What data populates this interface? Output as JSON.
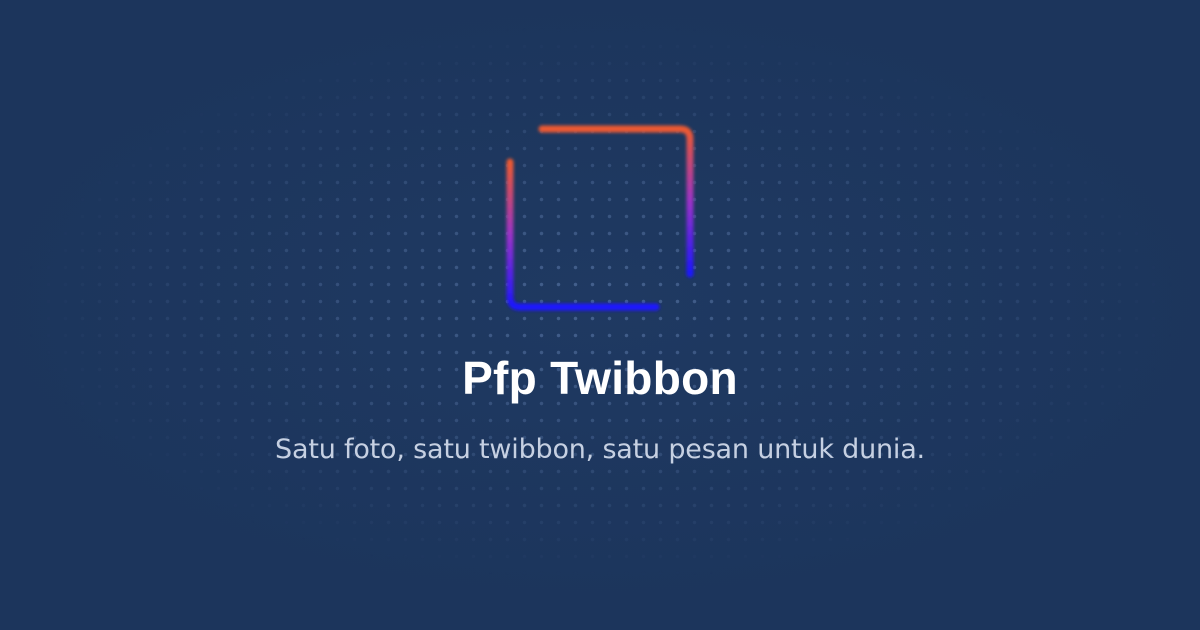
{
  "logo": {
    "icon": "gradient-square-frame-icon",
    "colors": {
      "top": "#ee5a30",
      "middle": "#9c33c8",
      "bottom": "#1a14ff"
    }
  },
  "title": "Pfp Twibbon",
  "tagline": "Satu foto, satu twibbon, satu pesan untuk dunia.",
  "colors": {
    "background": "#1c355c",
    "dots": "#6e8cbe",
    "title": "#ffffff",
    "tagline": "#c6d0e2"
  }
}
